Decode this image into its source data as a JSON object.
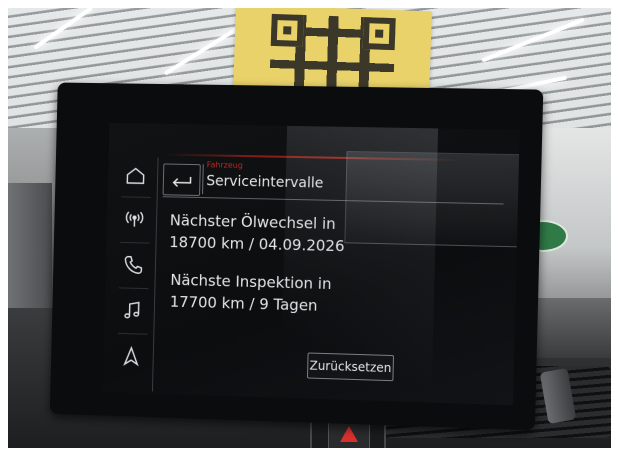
{
  "screen": {
    "header": {
      "category": "Fahrzeug",
      "title": "Serviceintervalle"
    },
    "oil_change": {
      "label": "Nächster Ölwechsel in",
      "value": "18700 km / 04.09.2026"
    },
    "inspection": {
      "label": "Nächste Inspektion in",
      "value": "17700 km / 9 Tagen"
    },
    "reset_button_label": "Zurücksetzen",
    "nav_items": [
      {
        "icon": "home-icon"
      },
      {
        "icon": "radio-antenna-icon"
      },
      {
        "icon": "phone-icon"
      },
      {
        "icon": "music-note-icon"
      },
      {
        "icon": "navigation-arrow-icon"
      }
    ]
  },
  "colors": {
    "accent_red": "#c0261d",
    "screen_background": "#0c0d0f",
    "text": "#e4e6e8"
  }
}
